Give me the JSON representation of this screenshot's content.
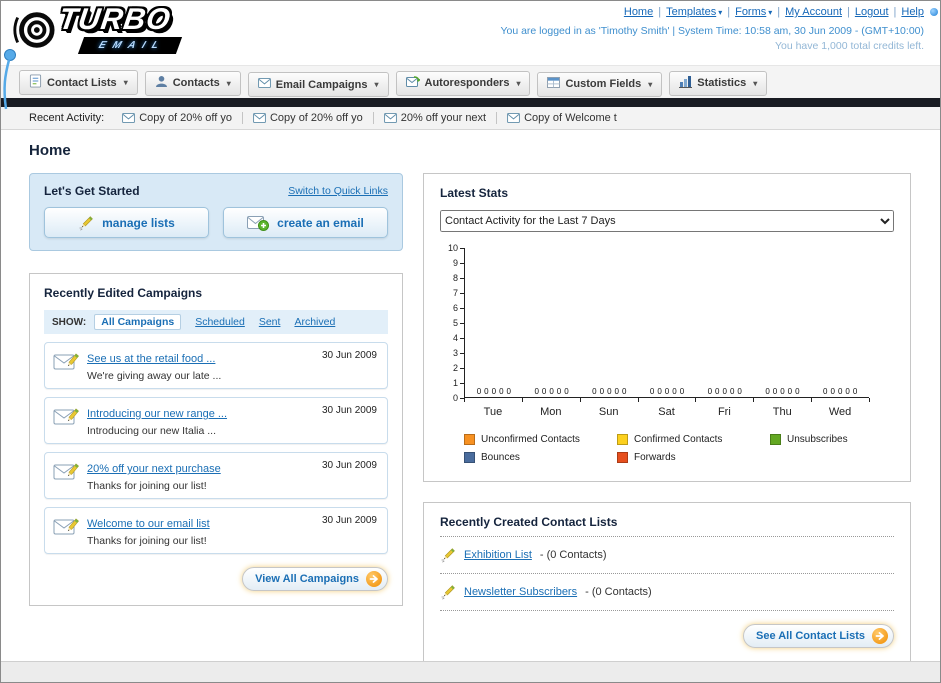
{
  "header": {
    "logo_title": "TURBO",
    "logo_subtitle": "EMAIL",
    "nav_links": [
      {
        "label": "Home",
        "dropdown": false
      },
      {
        "label": "Templates",
        "dropdown": true
      },
      {
        "label": "Forms",
        "dropdown": true
      },
      {
        "label": "My Account",
        "dropdown": false
      },
      {
        "label": "Logout",
        "dropdown": false
      },
      {
        "label": "Help",
        "dropdown": false
      }
    ],
    "login_info": "You are logged in as 'Timothy Smith' | System Time: 10:58 am, 30 Jun 2009 - (GMT+10:00)",
    "credits_info": "You have 1,000 total credits left."
  },
  "nav_tabs": [
    {
      "label": "Contact Lists",
      "icon": "contact-lists-icon"
    },
    {
      "label": "Contacts",
      "icon": "contacts-icon"
    },
    {
      "label": "Email Campaigns",
      "icon": "email-campaigns-icon"
    },
    {
      "label": "Autoresponders",
      "icon": "autoresponders-icon"
    },
    {
      "label": "Custom Fields",
      "icon": "custom-fields-icon"
    },
    {
      "label": "Statistics",
      "icon": "statistics-icon"
    }
  ],
  "recent_activity": {
    "label": "Recent Activity:",
    "items": [
      "Copy of 20% off yo",
      "Copy of 20% off yo",
      "20% off your next",
      "Copy of Welcome t"
    ]
  },
  "page_title": "Home",
  "get_started": {
    "title": "Let's Get Started",
    "switch_link": "Switch to Quick Links",
    "manage_lists_label": "manage lists",
    "create_email_label": "create an email"
  },
  "campaigns": {
    "title": "Recently Edited Campaigns",
    "show_label": "SHOW:",
    "filters": [
      {
        "label": "All Campaigns",
        "selected": true
      },
      {
        "label": "Scheduled",
        "selected": false
      },
      {
        "label": "Sent",
        "selected": false
      },
      {
        "label": "Archived",
        "selected": false
      }
    ],
    "items": [
      {
        "title": "See us at the retail food ...",
        "subtitle": "We're giving away our late ...",
        "date": "30 Jun 2009"
      },
      {
        "title": "Introducing our new range ...",
        "subtitle": "Introducing our new Italia ...",
        "date": "30 Jun 2009"
      },
      {
        "title": "20% off your next purchase",
        "subtitle": "Thanks for joining our list!",
        "date": "30 Jun 2009"
      },
      {
        "title": "Welcome to our email list",
        "subtitle": "Thanks for joining our list!",
        "date": "30 Jun 2009"
      }
    ],
    "view_all_label": "View All Campaigns"
  },
  "stats": {
    "title": "Latest Stats",
    "period_selected": "Contact Activity for the Last 7 Days"
  },
  "chart_data": {
    "type": "bar",
    "title": "Contact Activity for the Last 7 Days",
    "categories": [
      "Tue",
      "Mon",
      "Sun",
      "Sat",
      "Fri",
      "Thu",
      "Wed"
    ],
    "series": [
      {
        "name": "Unconfirmed Contacts",
        "color": "#f79122",
        "values": [
          0,
          0,
          0,
          0,
          0,
          0,
          0
        ]
      },
      {
        "name": "Confirmed Contacts",
        "color": "#fcd01e",
        "values": [
          0,
          0,
          0,
          0,
          0,
          0,
          0
        ]
      },
      {
        "name": "Unsubscribes",
        "color": "#63a822",
        "values": [
          0,
          0,
          0,
          0,
          0,
          0,
          0
        ]
      },
      {
        "name": "Bounces",
        "color": "#4a6c9d",
        "values": [
          0,
          0,
          0,
          0,
          0,
          0,
          0
        ]
      },
      {
        "name": "Forwards",
        "color": "#e64f1e",
        "values": [
          0,
          0,
          0,
          0,
          0,
          0,
          0
        ]
      }
    ],
    "ylim": [
      0,
      10
    ],
    "ytick_step": 1,
    "grid": false,
    "legend_position": "bottom",
    "show_value_labels": true
  },
  "contact_lists": {
    "title": "Recently Created Contact Lists",
    "items": [
      {
        "name": "Exhibition List",
        "count_text": "- (0 Contacts)"
      },
      {
        "name": "Newsletter Subscribers",
        "count_text": "- (0 Contacts)"
      }
    ],
    "see_all_label": "See All Contact Lists"
  }
}
